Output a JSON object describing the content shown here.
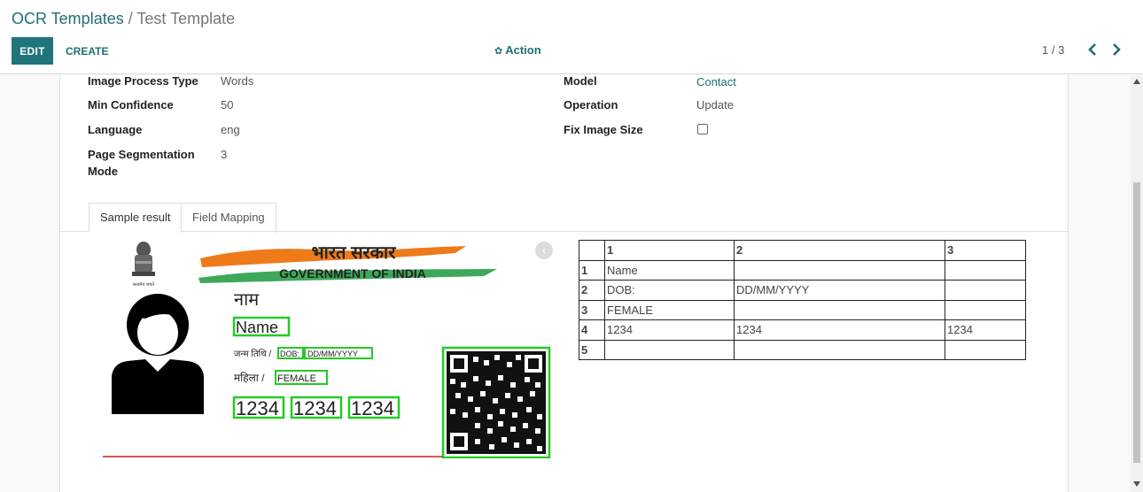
{
  "breadcrumb": {
    "parent": "OCR Templates",
    "separator": " / ",
    "current": "Test Template"
  },
  "buttons": {
    "edit": "EDIT",
    "create": "CREATE",
    "action": "Action"
  },
  "pager": {
    "value": "1 / 3"
  },
  "icons": {
    "action": "gear-icon",
    "prev": "chevron-left-icon",
    "next": "chevron-right-icon",
    "collapse": "chevron-left-icon"
  },
  "colors": {
    "brand": "#20757d",
    "link": "#1f6f75",
    "box": "#22cc22"
  },
  "form": {
    "image_process_type_label": "Image Process Type",
    "image_process_type": "Words",
    "min_confidence_label": "Min Confidence",
    "min_confidence": "50",
    "language_label": "Language",
    "language": "eng",
    "page_segmentation_label_1": "Page Segmentation",
    "page_segmentation_label_2": "Mode",
    "page_segmentation": "3",
    "model_label": "Model",
    "model": "Contact",
    "operation_label": "Operation",
    "operation": "Update",
    "fix_image_size_label": "Fix Image Size",
    "fix_image_size": false
  },
  "tabs": [
    {
      "label": "Sample result",
      "active": true
    },
    {
      "label": "Field Mapping",
      "active": false
    }
  ],
  "card": {
    "hindi_title": "भारत सरकार",
    "gov_text": "GOVERNMENT OF INDIA",
    "emblem_caption": "सत्यमेव जयते",
    "name_hindi": "नाम",
    "name": "Name",
    "dob_prefix": "जन्म तिथि /",
    "dob_label": "DOB:",
    "dob_value": "DD/MM/YYYY",
    "gender_prefix": "महिला /",
    "gender": "FEMALE",
    "number_parts": [
      "1234",
      "1234",
      "1234"
    ]
  },
  "result_table": {
    "headers": [
      "",
      "1",
      "2",
      "3"
    ],
    "rows": [
      [
        "1",
        "Name",
        "",
        ""
      ],
      [
        "2",
        "DOB:",
        "DD/MM/YYYY",
        ""
      ],
      [
        "3",
        "FEMALE",
        "",
        ""
      ],
      [
        "4",
        "1234",
        "1234",
        "1234"
      ],
      [
        "5",
        "",
        "",
        ""
      ]
    ]
  }
}
